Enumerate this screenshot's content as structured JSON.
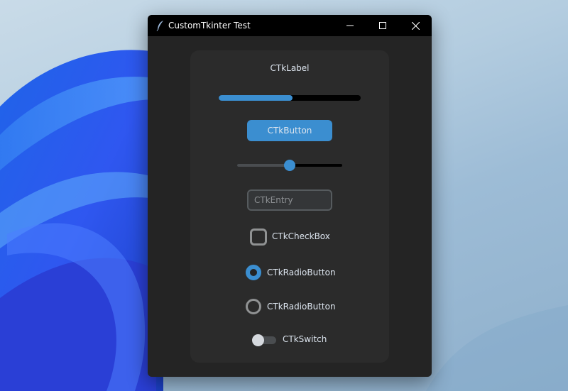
{
  "window": {
    "title": "CustomTkinter Test",
    "minimize_icon": "minimize-icon",
    "maximize_icon": "maximize-icon",
    "close_icon": "close-icon",
    "app_icon": "feather-icon"
  },
  "frame": {
    "label": "CTkLabel",
    "progress": 0.52,
    "button_label": "CTkButton",
    "slider_value": 0.5,
    "entry": {
      "value": "",
      "placeholder": "CTkEntry"
    },
    "checkbox": {
      "label": "CTkCheckBox",
      "checked": false
    },
    "radio_buttons": [
      {
        "label": "CTkRadioButton",
        "selected": true
      },
      {
        "label": "CTkRadioButton",
        "selected": false
      }
    ],
    "switch": {
      "label": "CTkSwitch",
      "on": false
    }
  },
  "colors": {
    "accent": "#3b8ed0",
    "window_bg": "#242424",
    "frame_bg": "#2b2b2b",
    "text": "#dce4ee",
    "titlebar": "#000000"
  }
}
